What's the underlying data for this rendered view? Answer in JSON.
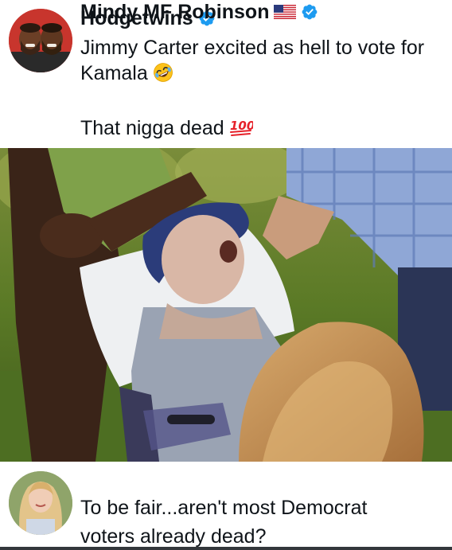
{
  "post1": {
    "author_name": "Hodgetwins",
    "avatar_icon": "avatar-two-men",
    "verified_icon": "verified-badge-icon",
    "text_line1": "Jimmy Carter excited as hell to vote for",
    "text_line2": "Kamala",
    "text_line2_emoji": "rolling-on-floor-laughing-emoji",
    "text_line3": "That nigga dead",
    "text_line3_emoji": "hundred-points-emoji"
  },
  "media": {
    "description_icon": "video-still-image"
  },
  "post2": {
    "author_name": "Mindy MF Robinson",
    "avatar_icon": "avatar-woman",
    "flag_icon": "us-flag-icon",
    "verified_icon": "verified-badge-icon",
    "text_line1": "To be fair...aren't most Democrat",
    "text_line2": "voters already dead?"
  },
  "colors": {
    "text": "#0f1419",
    "verified_blue": "#1d9bf0",
    "background": "#ffffff"
  }
}
